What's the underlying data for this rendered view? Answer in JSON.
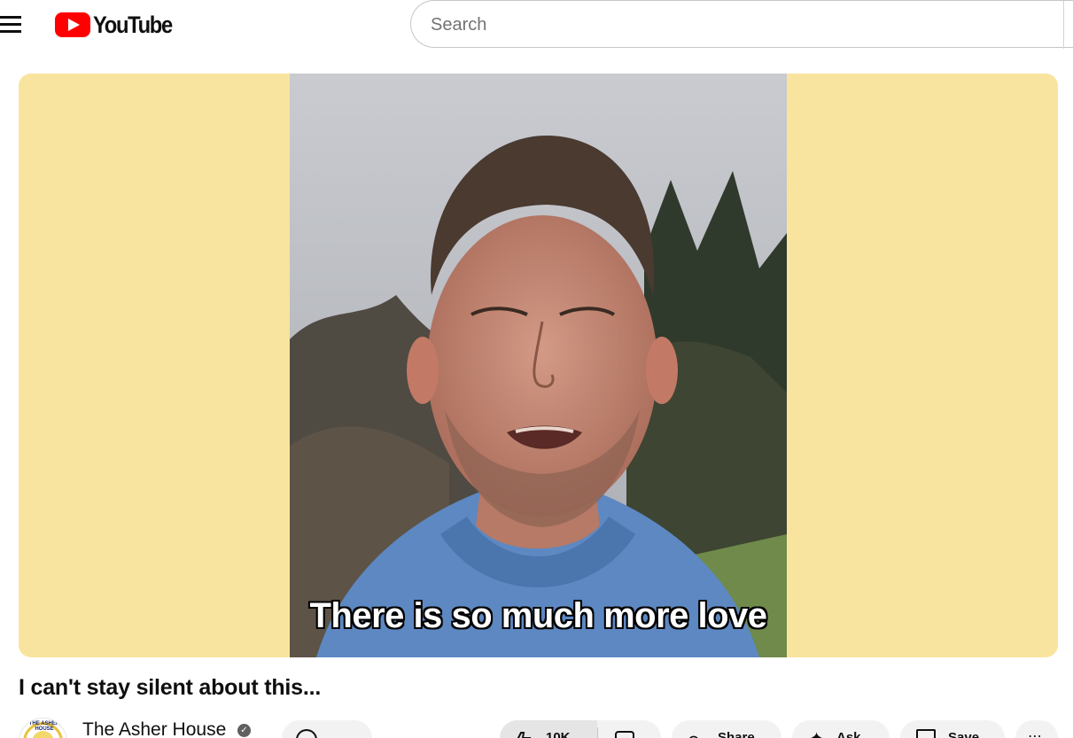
{
  "header": {
    "logo_text": "YouTube",
    "search_placeholder": "Search"
  },
  "player": {
    "caption": "There is so much more love",
    "background_color": "#f8e49e"
  },
  "video": {
    "title": "I can't stay silent about this..."
  },
  "channel": {
    "name": "The Asher House",
    "avatar_text": "THE ASHER HOUSE",
    "verified_glyph": "✓",
    "bell_dots": "⋯"
  },
  "actions": {
    "like_count": "10K",
    "share_label": "Share",
    "ask_label": "Ask",
    "save_label": "Save",
    "more_label": "⋯"
  },
  "icons": [
    "menu-icon",
    "youtube-logo-icon",
    "bell-icon",
    "like-icon",
    "dislike-icon",
    "share-icon",
    "ask-icon",
    "save-icon",
    "more-icon",
    "verified-icon"
  ],
  "colors": {
    "brand_red": "#ff0000",
    "pill_bg": "#f2f2f2",
    "text": "#0f0f0f"
  }
}
